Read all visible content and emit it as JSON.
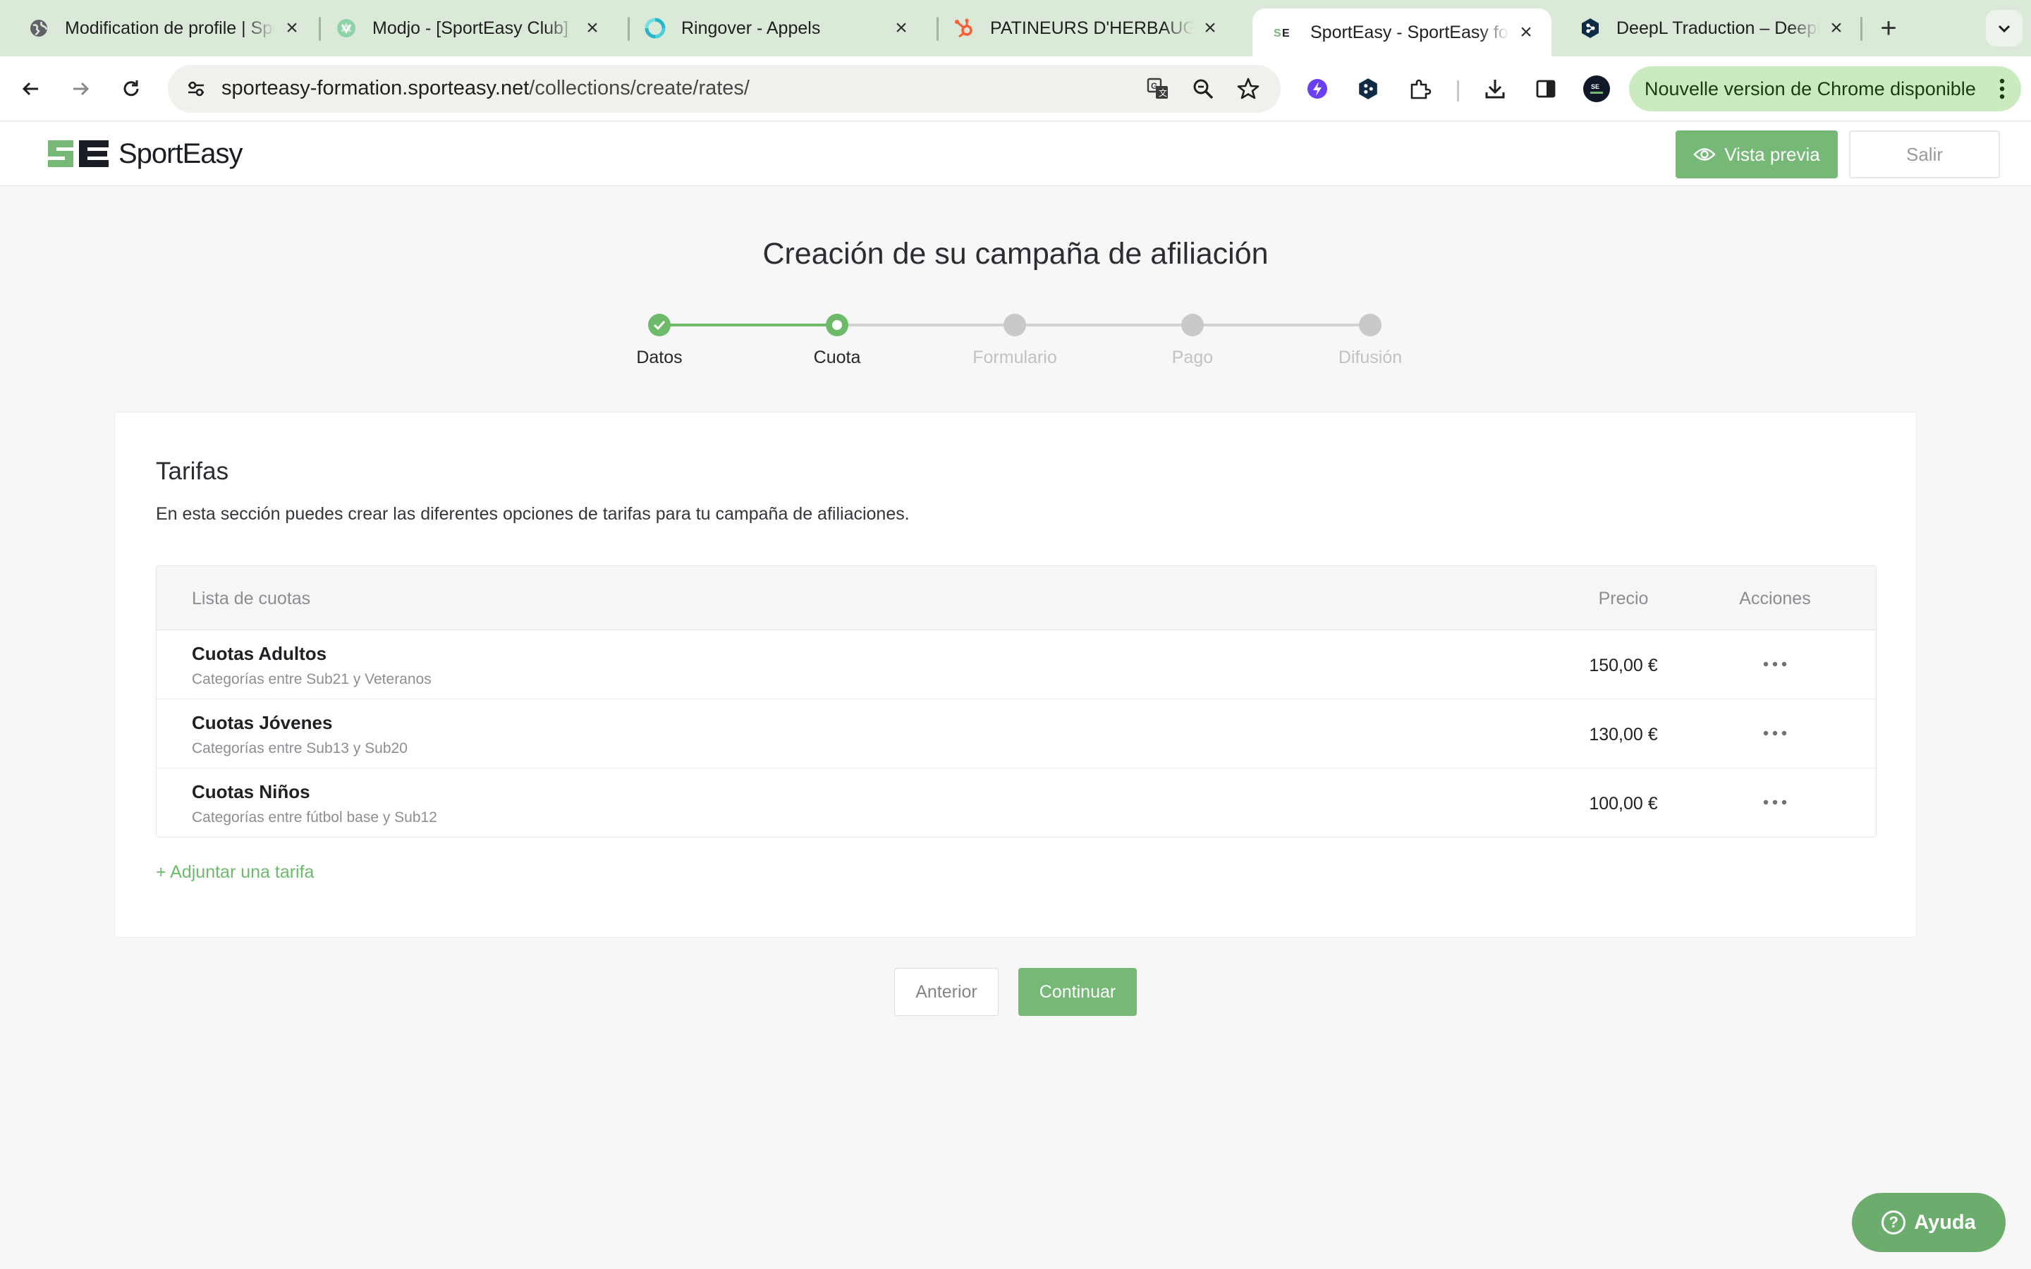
{
  "browser": {
    "tabs": [
      {
        "title": "Modification de profile | SportEasy",
        "favicon": "globe-icon"
      },
      {
        "title": "Modjo - [SportEasy Club]",
        "favicon": "modjo-icon"
      },
      {
        "title": "Ringover - Appels",
        "favicon": "ringover-icon"
      },
      {
        "title": "PATINEURS D'HERBAUGES",
        "favicon": "hubspot-icon"
      },
      {
        "title": "SportEasy - SportEasy formation",
        "favicon": "sporteasy-icon",
        "active": true
      },
      {
        "title": "DeepL Traduction – DeepL",
        "favicon": "deepl-icon"
      }
    ],
    "url_host": "sporteasy-formation.sporteasy.net",
    "url_path": "/collections/create/rates/",
    "update_notice": "Nouvelle version de Chrome disponible"
  },
  "header": {
    "logo_text": "SportEasy",
    "preview_label": "Vista previa",
    "exit_label": "Salir"
  },
  "page": {
    "title": "Creación de su campaña de afiliación"
  },
  "stepper": {
    "steps": [
      {
        "label": "Datos",
        "state": "done"
      },
      {
        "label": "Cuota",
        "state": "current"
      },
      {
        "label": "Formulario",
        "state": "todo"
      },
      {
        "label": "Pago",
        "state": "todo"
      },
      {
        "label": "Difusión",
        "state": "todo"
      }
    ]
  },
  "rates": {
    "title": "Tarifas",
    "description": "En esta sección puedes crear las diferentes opciones de tarifas para tu campaña de afiliaciones.",
    "columns": {
      "list": "Lista de cuotas",
      "price": "Precio",
      "actions": "Acciones"
    },
    "rows": [
      {
        "name": "Cuotas Adultos",
        "detail": "Categorías entre Sub21 y Veteranos",
        "price": "150,00 €"
      },
      {
        "name": "Cuotas Jóvenes",
        "detail": "Categorías entre Sub13 y Sub20",
        "price": "130,00 €"
      },
      {
        "name": "Cuotas Niños",
        "detail": "Categorías entre fútbol base y Sub12",
        "price": "100,00 €"
      }
    ],
    "add_label": "+ Adjuntar una tarifa"
  },
  "footer": {
    "prev_label": "Anterior",
    "next_label": "Continuar"
  },
  "help": {
    "label": "Ayuda"
  },
  "colors": {
    "brand_green": "#76b876",
    "step_green": "#6dbb6a",
    "tab_strip": "#dbe9d8"
  }
}
